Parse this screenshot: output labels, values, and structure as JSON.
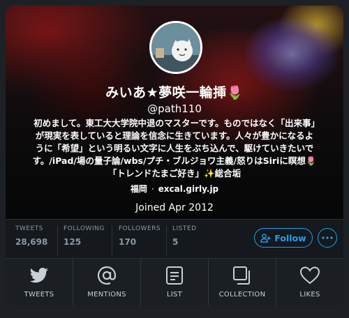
{
  "profile": {
    "display_name": "みいあ★夢咲一輪挿🌷",
    "handle": "@path110",
    "bio": "初めまして。東工大大学院中退のマスターです。ものではなく「出来事」が現実を表していると理論を信念に生きています。人々が豊かになるように「希望」という明るい文字に人生をぶち込んで、駆けていきたいです。/iPad/場の量子論/wbs/プチ・ブルジョワ主義/怒りはSiriに瞑想🌷「トレンドたまご好き」✨総合垢",
    "location": "福岡",
    "separator": "·",
    "url": "excal.girly.jp",
    "joined": "Joined Apr 2012"
  },
  "stats": [
    {
      "label": "TWEETS",
      "value": "28,698"
    },
    {
      "label": "FOLLOWING",
      "value": "125"
    },
    {
      "label": "FOLLOWERS",
      "value": "170"
    },
    {
      "label": "LISTED",
      "value": "5"
    }
  ],
  "actions": {
    "follow_label": "Follow",
    "follow_icon": "add-user-icon",
    "more_icon": "more-icon"
  },
  "tabs": [
    {
      "label": "TWEETS",
      "icon": "bird-icon"
    },
    {
      "label": "MENTIONS",
      "icon": "at-icon"
    },
    {
      "label": "LIST",
      "icon": "list-icon"
    },
    {
      "label": "COLLECTION",
      "icon": "collection-icon"
    },
    {
      "label": "LIKES",
      "icon": "heart-icon"
    }
  ],
  "colors": {
    "accent": "#1da1f2",
    "card_bg": "#15181c",
    "muted": "#8899a6"
  }
}
